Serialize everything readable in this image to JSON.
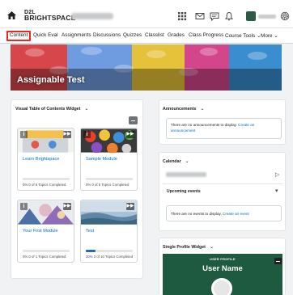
{
  "header": {
    "logo_line1": "D2L",
    "logo_line2": "BRIGHTSPACE",
    "icons": [
      "home-icon",
      "grid-icon",
      "mail-icon",
      "chat-icon",
      "bell-icon",
      "gear-icon"
    ]
  },
  "nav": {
    "items": [
      "Content",
      "Quick Eval",
      "Assignments",
      "Discussions",
      "Quizzes",
      "Classlist",
      "Grades",
      "Class Progress",
      "Course Tools ⌄",
      "More ⌄"
    ],
    "active": "Content",
    "highlight_color": "#e8291f"
  },
  "banner": {
    "title": "Assignable Test"
  },
  "toc_widget": {
    "title": "Visual Table of Contents Widget",
    "cards": [
      {
        "title": "Learn Brightspace",
        "progress_percent": 0,
        "progress_text": "0%    0 of 6 Topics Completed"
      },
      {
        "title": "Sample Module",
        "progress_percent": 0,
        "progress_text": "0%    0 of 5 Topics Completed"
      },
      {
        "title": "Your First Module",
        "progress_percent": 0,
        "progress_text": "0%    0 of 1 Topics Completed"
      },
      {
        "title": "Test",
        "progress_percent": 20,
        "progress_text": "20%   2 of 10 Topics Completed"
      }
    ]
  },
  "announcements": {
    "title": "Announcements",
    "message": "There are no announcements to display.",
    "link": "Create an announcement"
  },
  "calendar": {
    "title": "Calendar",
    "upcoming_title": "Upcoming events",
    "message": "There are no events to display.",
    "link": "Create an event"
  },
  "profile": {
    "title": "Single Profile Widget",
    "label": "USER PROFILE",
    "name": "User Name"
  },
  "colors": {
    "link": "#006fbf",
    "progress": "#2a6ab1",
    "profile_bg": "#1d5a40"
  }
}
